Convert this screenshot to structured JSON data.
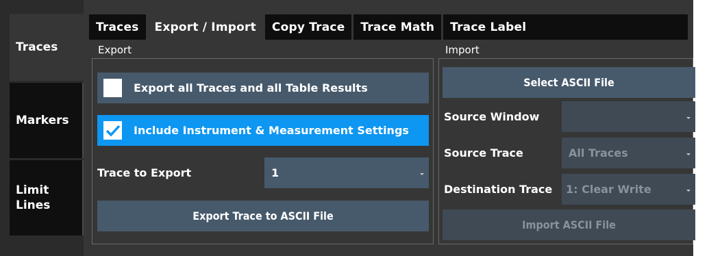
{
  "sidebar": {
    "items": [
      {
        "label": "Traces"
      },
      {
        "label": "Markers"
      },
      {
        "label": "Limit\nLines"
      }
    ]
  },
  "tabs": [
    {
      "label": "Traces"
    },
    {
      "label": "Export / Import"
    },
    {
      "label": "Copy Trace"
    },
    {
      "label": "Trace Math"
    },
    {
      "label": "Trace Label"
    }
  ],
  "export": {
    "title": "Export",
    "export_all": {
      "label": "Export all Traces and all Table Results",
      "checked": false
    },
    "include_settings": {
      "label": "Include Instrument & Measurement Settings",
      "checked": true
    },
    "trace_to_export": {
      "label": "Trace to Export",
      "value": "1"
    },
    "export_button": "Export Trace to ASCII File"
  },
  "import": {
    "title": "Import",
    "select_button": "Select ASCII File",
    "source_window": {
      "label": "Source Window",
      "value": ""
    },
    "source_trace": {
      "label": "Source Trace",
      "value": "All Traces"
    },
    "destination_trace": {
      "label": "Destination Trace",
      "value": "1: Clear Write"
    },
    "import_button": "Import ASCII File"
  },
  "colors": {
    "background": "#363636",
    "tab_inactive": "#0e0e0e",
    "button": "#475a6c",
    "checked_row": "#0d96f2",
    "disabled_text": "#8a929a"
  }
}
